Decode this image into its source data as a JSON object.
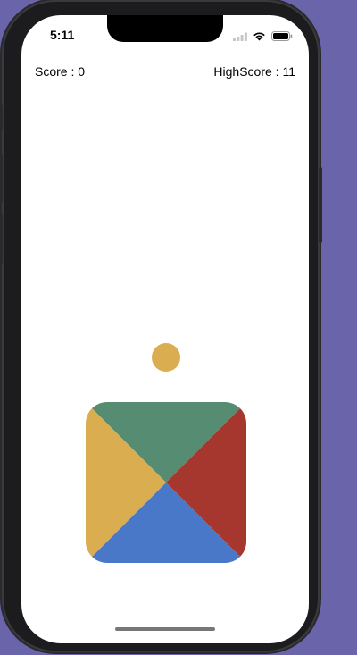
{
  "status_bar": {
    "time": "5:11"
  },
  "hud": {
    "score_text": "Score : 0",
    "highscore_text": "HighScore : 11"
  },
  "ball": {
    "color": "#d9ad50"
  },
  "board": {
    "segments": [
      {
        "position": "top",
        "color": "#568d72"
      },
      {
        "position": "right",
        "color": "#a5372f"
      },
      {
        "position": "bottom",
        "color": "#4878c7"
      },
      {
        "position": "left",
        "color": "#d9ad50"
      }
    ]
  },
  "colors": {
    "background": "#6a65aa",
    "screen": "#ffffff"
  }
}
